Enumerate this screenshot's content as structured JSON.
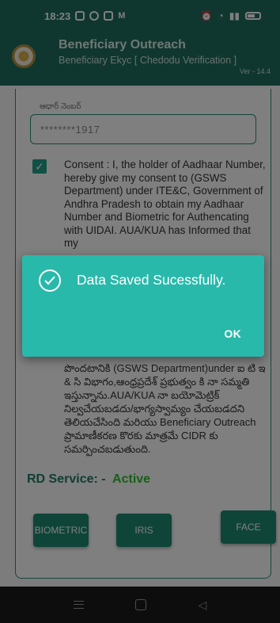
{
  "statusbar": {
    "time": "18:23"
  },
  "appbar": {
    "title": "Beneficiary Outreach",
    "subtitle": "Beneficiary Ekyc [ Chedodu Verification ]",
    "version": "Ver - 14.4"
  },
  "form": {
    "aadhaar_label": "ఆధార్ నెంబర్",
    "aadhaar_value": "********1917",
    "consent_checked": true,
    "consent_en": "Consent : I, the holder of Aadhaar Number, hereby give my consent to (GSWS Department) under ITE&C, Government of Andhra Pradesh to obtain my Aadhaar Number and Biometric for Authencating with UIDAI. AUA/KUA has Informed that my",
    "consent_te": "పొందటానికి (GSWS Department)under ఐ టి ఇ & సి విభాగం,ఆంధ్రప్రదేశ్ ప్రభుత్వం కి నా సమ్మతి ఇస్తున్నాను.AUA/KUA నా బయోమెట్రిక్ నిల్వచేయబడదు/భాగ్యస్వామ్యం చేయబడదని తెలియచేసింది మరియు Beneficiary Outreach ప్రామాణీకరణ కొరకు మాత్రమే CIDR కు సమర్పించబడుతుంది.",
    "rd_label": "RD Service: -",
    "rd_status": "Active"
  },
  "buttons": {
    "biometric": "BIOMETRIC",
    "iris": "IRIS",
    "face": "FACE"
  },
  "dialog": {
    "message": "Data Saved Sucessfully.",
    "ok": "OK"
  },
  "colors": {
    "primary": "#1f6f5e",
    "accent": "#28b9ab",
    "active": "#2ebd2e"
  }
}
